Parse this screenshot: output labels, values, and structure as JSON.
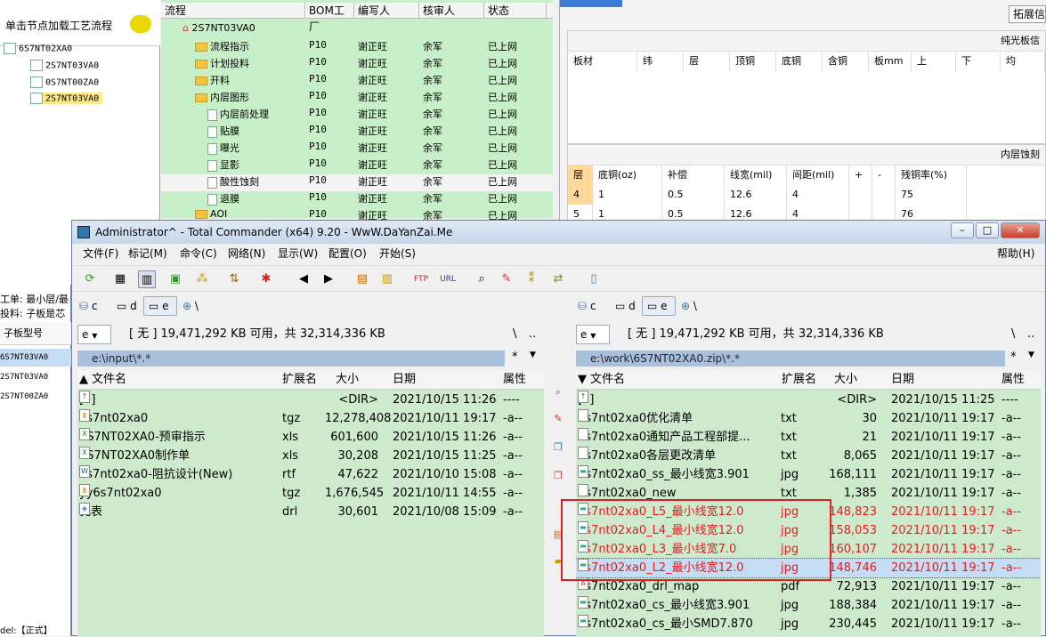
{
  "bg_app": {
    "tree_title": "单击节点加载工艺流程",
    "tree_nodes": [
      "6S7NT02XA0",
      "2S7NT03VA0",
      "0S7NT00ZA0",
      "2S7NT03VA0"
    ],
    "proc_columns": [
      "流程",
      "BOM工厂",
      "编写人",
      "核审人",
      "状态"
    ],
    "proc_root": "2S7NT03VA0",
    "proc_rows": [
      {
        "name": "流程指示",
        "f": "P10",
        "w": "谢正旺",
        "r": "余军",
        "s": "已上网"
      },
      {
        "name": "计划投料",
        "f": "P10",
        "w": "谢正旺",
        "r": "余军",
        "s": "已上网"
      },
      {
        "name": "开料",
        "f": "P10",
        "w": "谢正旺",
        "r": "余军",
        "s": "已上网"
      },
      {
        "name": "内层图形",
        "f": "P10",
        "w": "谢正旺",
        "r": "余军",
        "s": "已上网"
      },
      {
        "name": "内层前处理",
        "f": "P10",
        "w": "谢正旺",
        "r": "余军",
        "s": "已上网"
      },
      {
        "name": "贴膜",
        "f": "P10",
        "w": "谢正旺",
        "r": "余军",
        "s": "已上网"
      },
      {
        "name": "曝光",
        "f": "P10",
        "w": "谢正旺",
        "r": "余军",
        "s": "已上网"
      },
      {
        "name": "显影",
        "f": "P10",
        "w": "谢正旺",
        "r": "余军",
        "s": "已上网"
      },
      {
        "name": "酸性蚀刻",
        "f": "P10",
        "w": "谢正旺",
        "r": "余军",
        "s": "已上网"
      },
      {
        "name": "退膜",
        "f": "P10",
        "w": "谢正旺",
        "r": "余军",
        "s": "已上网"
      },
      {
        "name": "AOI",
        "f": "P10",
        "w": "谢正旺",
        "r": "余军",
        "s": "已上网"
      }
    ],
    "right_tab": "拓展信",
    "grid1_title": "纯光板信",
    "grid1_cols": [
      "板材",
      "纬",
      "层",
      "顶铜",
      "底铜",
      "含铜",
      "板mm",
      "上",
      "下",
      "均"
    ],
    "grid2_title": "内层蚀刻",
    "grid2_cols": [
      "层",
      "底铜(oz)",
      "补偿",
      "线宽(mil)",
      "间距(mil)",
      "+",
      "-",
      "残铜率(%)"
    ],
    "grid2_rows": [
      [
        "4",
        "1",
        "0.5",
        "12.6",
        "4",
        "",
        "",
        "75"
      ],
      [
        "5",
        "1",
        "0.5",
        "12.6",
        "4",
        "",
        "",
        "76"
      ]
    ],
    "left_labels": [
      "工单: 最小层/最",
      "投料: 子板是芯"
    ],
    "left_col": "子板型号",
    "left_rows": [
      "6S7NT03VA0",
      "2S7NT03VA0",
      "2S7NT00ZA0"
    ],
    "left_bottom": "del:【正式】"
  },
  "tc": {
    "title": "Administrator^ - Total Commander (x64) 9.20 - WwW.DaYanZai.Me",
    "menu": [
      "文件(F)",
      "标记(M)",
      "命令(C)",
      "网络(N)",
      "显示(W)",
      "配置(O)",
      "开始(S)"
    ],
    "help": "帮助(H)",
    "drives": [
      "c",
      "d",
      "e"
    ],
    "drive_combo": "e",
    "disk_info": "[ 无 ]  19,471,292 KB 可用，共 32,314,336 KB",
    "root_sym": "\\",
    "up_sym": "..",
    "filter": "*",
    "col_headers": [
      "文件名",
      "扩展名",
      "大小",
      "日期",
      "属性"
    ],
    "left": {
      "path": "e:\\input\\*.*",
      "files": [
        {
          "name": "[..]",
          "ext": "",
          "size": "<DIR>",
          "date": "2021/10/15 11:26",
          "attr": "----",
          "icon": "up-icon"
        },
        {
          "name": "6s7nt02xa0",
          "ext": "tgz",
          "size": "12,278,408",
          "date": "2021/10/11 19:17",
          "attr": "-a--",
          "icon": "archive-icon"
        },
        {
          "name": "6S7NT02XA0-预审指示",
          "ext": "xls",
          "size": "601,600",
          "date": "2021/10/15 11:26",
          "attr": "-a--",
          "icon": "excel-icon"
        },
        {
          "name": "6S7NT02XA0制作单",
          "ext": "xls",
          "size": "30,208",
          "date": "2021/10/15 11:25",
          "attr": "-a--",
          "icon": "excel-icon"
        },
        {
          "name": "6s7nt02xa0-阻抗设计(New)",
          "ext": "rtf",
          "size": "47,622",
          "date": "2021/10/10 15:08",
          "attr": "-a--",
          "icon": "doc-icon"
        },
        {
          "name": "yy6s7nt02xa0",
          "ext": "tgz",
          "size": "1,676,545",
          "date": "2021/10/11 14:55",
          "attr": "-a--",
          "icon": "archive-icon"
        },
        {
          "name": "孔表",
          "ext": "drl",
          "size": "30,601",
          "date": "2021/10/08 15:09",
          "attr": "-a--",
          "icon": "drill-icon"
        }
      ]
    },
    "right": {
      "path": "e:\\work\\6S7NT02XA0.zip\\*.*",
      "files": [
        {
          "name": "[..]",
          "ext": "",
          "size": "<DIR>",
          "date": "2021/10/15 11:25",
          "attr": "----",
          "icon": "up-icon",
          "red": false
        },
        {
          "name": "6s7nt02xa0优化清单",
          "ext": "txt",
          "size": "30",
          "date": "2021/10/11 19:17",
          "attr": "-a--",
          "icon": "text-file-icon",
          "red": false
        },
        {
          "name": "6s7nt02xa0通知产品工程部提...",
          "ext": "txt",
          "size": "21",
          "date": "2021/10/11 19:17",
          "attr": "-a--",
          "icon": "text-file-icon",
          "red": false
        },
        {
          "name": "6s7nt02xa0各层更改清单",
          "ext": "txt",
          "size": "8,065",
          "date": "2021/10/11 19:17",
          "attr": "-a--",
          "icon": "text-file-icon",
          "red": false
        },
        {
          "name": "6s7nt02xa0_ss_最小线宽3.901",
          "ext": "jpg",
          "size": "168,111",
          "date": "2021/10/11 19:17",
          "attr": "-a--",
          "icon": "image-icon",
          "red": false
        },
        {
          "name": "6s7nt02xa0_new",
          "ext": "txt",
          "size": "1,385",
          "date": "2021/10/11 19:17",
          "attr": "-a--",
          "icon": "text-file-icon",
          "red": false
        },
        {
          "name": "6s7nt02xa0_L5_最小线宽12.0",
          "ext": "jpg",
          "size": "148,823",
          "date": "2021/10/11 19:17",
          "attr": "-a--",
          "icon": "image-icon",
          "red": true
        },
        {
          "name": "6s7nt02xa0_L4_最小线宽12.0",
          "ext": "jpg",
          "size": "158,053",
          "date": "2021/10/11 19:17",
          "attr": "-a--",
          "icon": "image-icon",
          "red": true
        },
        {
          "name": "6s7nt02xa0_L3_最小线宽7.0",
          "ext": "jpg",
          "size": "160,107",
          "date": "2021/10/11 19:17",
          "attr": "-a--",
          "icon": "image-icon",
          "red": true
        },
        {
          "name": "6s7nt02xa0_L2_最小线宽12.0",
          "ext": "jpg",
          "size": "148,746",
          "date": "2021/10/11 19:17",
          "attr": "-a--",
          "icon": "image-icon",
          "red": true
        },
        {
          "name": "6s7nt02xa0_drl_map",
          "ext": "pdf",
          "size": "72,913",
          "date": "2021/10/11 19:17",
          "attr": "-a--",
          "icon": "pdf-icon",
          "red": false
        },
        {
          "name": "6s7nt02xa0_cs_最小线宽3.901",
          "ext": "jpg",
          "size": "188,384",
          "date": "2021/10/11 19:17",
          "attr": "-a--",
          "icon": "image-icon",
          "red": false
        },
        {
          "name": "6s7nt02xa0_cs_最小SMD7.870",
          "ext": "jpg",
          "size": "230,445",
          "date": "2021/10/11 19:17",
          "attr": "-a--",
          "icon": "image-icon",
          "red": false
        }
      ]
    },
    "colors": {
      "list_bg": "#cdeacd",
      "highlight_red": "#e02020",
      "selection": "#c5dcf5"
    }
  }
}
